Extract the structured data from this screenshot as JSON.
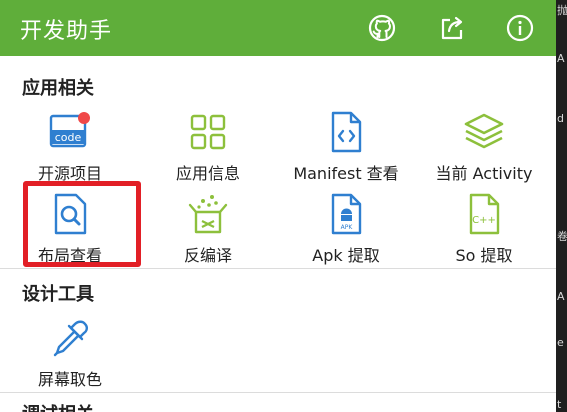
{
  "appbar": {
    "title": "开发助手",
    "actions": [
      {
        "name": "github-icon"
      },
      {
        "name": "share-icon"
      },
      {
        "name": "info-icon"
      }
    ],
    "color": "#5fae3a"
  },
  "sections": [
    {
      "title": "应用相关",
      "items": [
        {
          "label": "开源项目",
          "icon": "code-icon",
          "badge": true
        },
        {
          "label": "应用信息",
          "icon": "grid-icon"
        },
        {
          "label": "Manifest 查看",
          "icon": "code-file-icon"
        },
        {
          "label": "当前 Activity",
          "icon": "layers-icon"
        },
        {
          "label": "布局查看",
          "icon": "search-icon"
        },
        {
          "label": "反编译",
          "icon": "unpack-box-icon"
        },
        {
          "label": "Apk 提取",
          "icon": "apk-file-icon"
        },
        {
          "label": "So 提取",
          "icon": "cpp-file-icon"
        }
      ]
    },
    {
      "title": "设计工具",
      "items": [
        {
          "label": "屏幕取色",
          "icon": "eyedropper-icon"
        }
      ]
    },
    {
      "title": "调试相关",
      "items": []
    }
  ],
  "highlight": {
    "target": "布局查看",
    "color": "#e21f26"
  },
  "colors": {
    "icon_blue": "#2f7fd0",
    "icon_green": "#8dc03c",
    "badge_red": "#f04848"
  },
  "right_strip_chars": [
    "抛",
    "A",
    "d",
    "卷",
    "A",
    "e",
    "t"
  ]
}
